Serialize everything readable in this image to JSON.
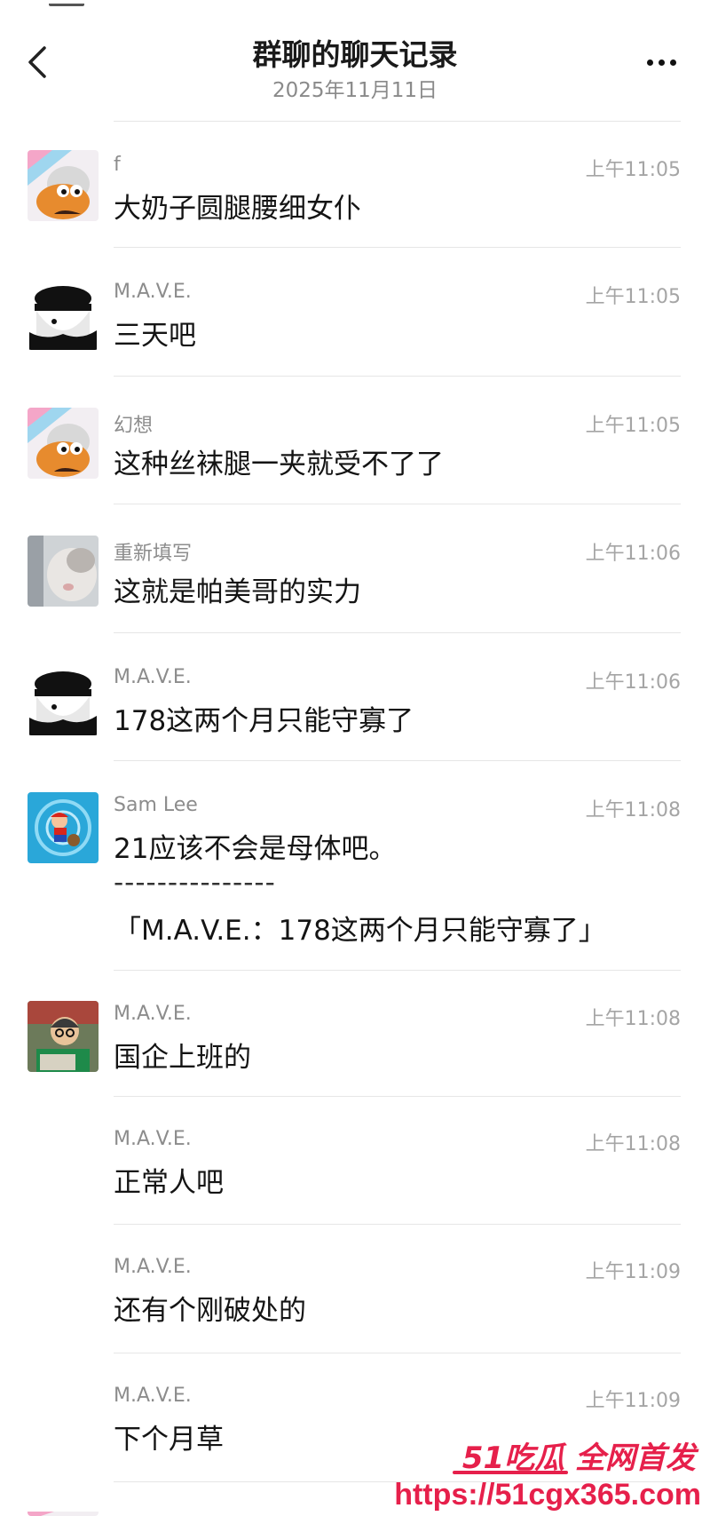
{
  "header": {
    "title": "群聊的聊天记录",
    "subtitle": "2025年11月11日"
  },
  "messages": [
    {
      "sender": "f",
      "time": "上午11:05",
      "text": "大奶子圆腿腰细女仆"
    },
    {
      "sender": "M.A.V.E.",
      "time": "上午11:05",
      "text": "三天吧"
    },
    {
      "sender": "幻想",
      "time": "上午11:05",
      "text": "这种丝袜腿一夹就受不了了"
    },
    {
      "sender": "重新填写",
      "time": "上午11:06",
      "text": "这就是帕美哥的实力"
    },
    {
      "sender": "M.A.V.E.",
      "time": "上午11:06",
      "text": "178这两个月只能守寡了"
    },
    {
      "sender": "Sam Lee",
      "time": "上午11:08",
      "text": "21应该不会是母体吧。",
      "quote_sep": "---------------",
      "quote": "「M.A.V.E.：178这两个月只能守寡了」"
    },
    {
      "sender": "M.A.V.E.",
      "time": "上午11:08",
      "text": "国企上班的"
    },
    {
      "sender": "M.A.V.E.",
      "time": "上午11:08",
      "text": "正常人吧"
    },
    {
      "sender": "M.A.V.E.",
      "time": "上午11:09",
      "text": "还有个刚破处的"
    },
    {
      "sender": "M.A.V.E.",
      "time": "上午11:09",
      "text": "下个月草"
    }
  ],
  "watermark": {
    "line1": "51吃瓜 全网首发",
    "line2": "https://51cgx365.com"
  },
  "colors": {
    "watermark": "#e6204b",
    "divider": "#e6e6e6",
    "sender": "#8c8c8c",
    "time": "#a5a5a5"
  }
}
